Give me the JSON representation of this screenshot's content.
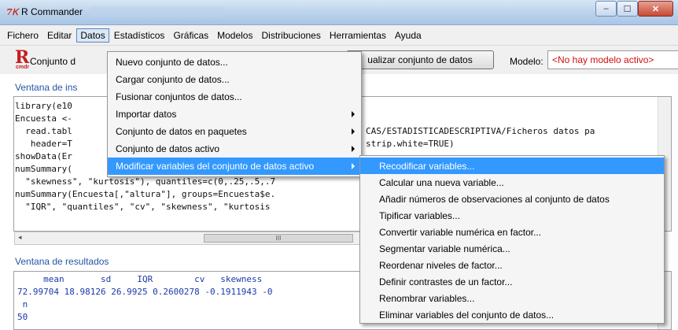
{
  "window": {
    "title": "R Commander",
    "minimize_glyph": "‒",
    "maximize_glyph": "☐",
    "close_glyph": "✕"
  },
  "menubar": [
    "Fichero",
    "Editar",
    "Datos",
    "Estadísticos",
    "Gráficas",
    "Modelos",
    "Distribuciones",
    "Herramientas",
    "Ayuda"
  ],
  "toolbar": {
    "logo_letter": "R",
    "logo_sub": "cmdr",
    "dataset_label": "Conjunto d",
    "view_button": "ualizar conjunto de datos",
    "model_label": "Modelo:",
    "model_value": "<No hay modelo activo>"
  },
  "script_window": {
    "label": "Ventana de ins",
    "lines": [
      "library(e10",
      "Encuesta <-",
      "  read.tabl",
      "   header=T",
      "showData(Er",
      "numSummary(",
      "  \"skewness\", \"kurtosis\"), quantiles=c(0,.25,.5,.7",
      "numSummary(Encuesta[,\"altura\"], groups=Encuesta$e.",
      "  \"IQR\", \"quantiles\", \"cv\", \"skewness\", \"kurtosis"
    ],
    "right_fragments": [
      "CAS/ESTADISTICADESCRIPTIVA/Ficheros datos pa",
      "strip.white=TRUE)"
    ],
    "scroll_thumb": "III"
  },
  "output_window": {
    "label": "Ventana de resultados",
    "lines": [
      "     mean       sd     IQR        cv   skewness",
      "72.99704 18.98126 26.9925 0.2600278 -0.1911943 -0",
      " n",
      "50"
    ]
  },
  "datos_menu": {
    "items": [
      {
        "label": "Nuevo conjunto de datos...",
        "submenu": false
      },
      {
        "label": "Cargar conjunto de datos...",
        "submenu": false
      },
      {
        "label": "Fusionar conjuntos de datos...",
        "submenu": false
      },
      {
        "label": "Importar datos",
        "submenu": true
      },
      {
        "label": "Conjunto de datos en paquetes",
        "submenu": true
      },
      {
        "label": "Conjunto de datos activo",
        "submenu": true
      },
      {
        "label": "Modificar variables del conjunto de datos activo",
        "submenu": true,
        "selected": true
      }
    ]
  },
  "modificar_submenu": {
    "items": [
      "Recodificar variables...",
      "Calcular una nueva variable...",
      "Añadir números de observaciones al conjunto de datos",
      "Tipificar variables...",
      "Convertir variable numérica en factor...",
      "Segmentar variable numérica...",
      "Reordenar niveles de factor...",
      "Definir contrastes de un factor...",
      "Renombrar variables...",
      "Eliminar variables del conjunto de datos..."
    ],
    "selected_index": 0
  },
  "colors": {
    "selection": "#3399ff",
    "section_label": "#2255a5",
    "output_text": "#1a3aa8",
    "model_text": "#d01010"
  }
}
